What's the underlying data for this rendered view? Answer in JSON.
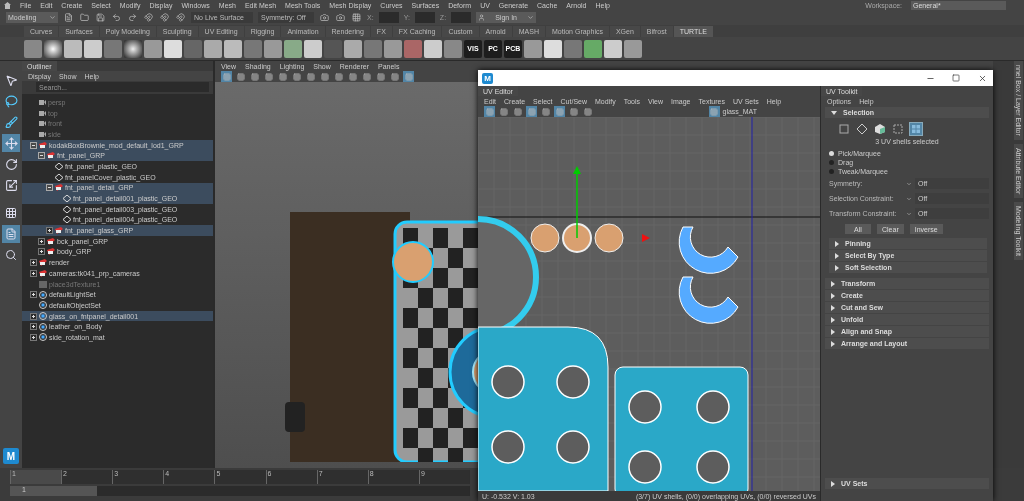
{
  "menu_bar": {
    "items": [
      "File",
      "Edit",
      "Create",
      "Select",
      "Modify",
      "Display",
      "Windows",
      "Mesh",
      "Edit Mesh",
      "Mesh Tools",
      "Mesh Display",
      "Curves",
      "Surfaces",
      "Deform",
      "UV",
      "Generate",
      "Cache",
      "Arnold",
      "Help"
    ],
    "workspace_label": "Workspace:",
    "workspace_value": "General*"
  },
  "status_line": {
    "mode": "Modeling",
    "live_surface": "No Live Surface",
    "symmetry": "Symmetry: Off",
    "coords": [
      "X:",
      "Y:",
      "Z:"
    ],
    "sign_in": "Sign In"
  },
  "shelf": {
    "tabs": [
      {
        "label": "Curves",
        "selected": false
      },
      {
        "label": "Surfaces",
        "selected": false
      },
      {
        "label": "Poly Modeling",
        "selected": false
      },
      {
        "label": "Sculpting",
        "selected": false
      },
      {
        "label": "UV Editing",
        "selected": false
      },
      {
        "label": "Rigging",
        "selected": false
      },
      {
        "label": "Animation",
        "selected": false
      },
      {
        "label": "Rendering",
        "selected": false
      },
      {
        "label": "FX",
        "selected": false
      },
      {
        "label": "FX Caching",
        "selected": false
      },
      {
        "label": "Custom",
        "selected": false
      },
      {
        "label": "Arnold",
        "selected": false
      },
      {
        "label": "MASH",
        "selected": false
      },
      {
        "label": "Motion Graphics",
        "selected": false
      },
      {
        "label": "XGen",
        "selected": false
      },
      {
        "label": "Bifrost",
        "selected": false
      },
      {
        "label": "TURTLE",
        "selected": true
      }
    ],
    "text_icons": [
      "VIS",
      "PC",
      "PCB"
    ]
  },
  "toolbox": {
    "tools": [
      {
        "kind": "select",
        "selected": false
      },
      {
        "kind": "lasso",
        "selected": false
      },
      {
        "kind": "paint",
        "selected": false
      },
      {
        "kind": "move",
        "selected": true
      },
      {
        "kind": "rotate",
        "selected": false
      },
      {
        "kind": "scale",
        "selected": false
      }
    ],
    "logo": "M"
  },
  "outliner": {
    "title": "Outliner",
    "menus": [
      "Display",
      "Show",
      "Help"
    ],
    "search_placeholder": "Search...",
    "items": [
      {
        "label": "persp",
        "kind": "camera",
        "dimmed": true,
        "selected": false
      },
      {
        "label": "top",
        "kind": "camera",
        "dimmed": true,
        "selected": false
      },
      {
        "label": "front",
        "kind": "camera",
        "dimmed": true,
        "selected": false
      },
      {
        "label": "side",
        "kind": "camera",
        "dimmed": true,
        "selected": false
      },
      {
        "label": "kodakBoxBrownie_mod_default_lod1_GRP",
        "kind": "group",
        "selected": true,
        "expanded": true,
        "children": [
          {
            "label": "fnt_panel_GRP",
            "kind": "group",
            "selected": true,
            "expanded": true,
            "children": [
              {
                "label": "fnt_panel_plastic_GEO",
                "kind": "mesh",
                "selected": false
              },
              {
                "label": "fnt_panelCover_plastic_GEO",
                "kind": "mesh",
                "selected": false
              },
              {
                "label": "fnt_panel_detail_GRP",
                "kind": "group",
                "selected": true,
                "expanded": true,
                "children": [
                  {
                    "label": "fnt_panel_detail001_plastic_GEO",
                    "kind": "mesh",
                    "selected": true
                  },
                  {
                    "label": "fnt_panel_detail003_plastic_GEO",
                    "kind": "mesh",
                    "selected": false
                  },
                  {
                    "label": "fnt_panel_detail004_plastic_GEO",
                    "kind": "mesh",
                    "selected": false
                  }
                ]
              },
              {
                "label": "fnt_panel_glass_GRP",
                "kind": "group",
                "selected": true,
                "expanded": false
              }
            ]
          },
          {
            "label": "bck_panel_GRP",
            "kind": "group",
            "selected": false,
            "expanded": false
          },
          {
            "label": "body_GRP",
            "kind": "group",
            "selected": false,
            "expanded": false
          }
        ]
      },
      {
        "label": "render",
        "kind": "group",
        "selected": false,
        "expanded": false
      },
      {
        "label": "cameras:tk041_prp_cameras",
        "kind": "group",
        "selected": false,
        "expanded": false
      },
      {
        "label": "place3dTexture1",
        "kind": "texture",
        "dimmed": true,
        "selected": false
      },
      {
        "label": "defaultLightSet",
        "kind": "set",
        "selected": false,
        "expanded": false
      },
      {
        "label": "defaultObjectSet",
        "kind": "set",
        "selected": false
      },
      {
        "label": "glass_on_fntpanel_detail001",
        "kind": "set",
        "selected": true,
        "expanded": false
      },
      {
        "label": "leather_on_Body",
        "kind": "set",
        "selected": false,
        "expanded": false
      },
      {
        "label": "side_rotation_mat",
        "kind": "set",
        "selected": false,
        "expanded": false
      }
    ]
  },
  "viewport": {
    "menus": [
      "View",
      "Shading",
      "Lighting",
      "Show",
      "Renderer",
      "Panels"
    ]
  },
  "uv_editor": {
    "logo": "M",
    "tab": "UV Editor",
    "menus": [
      "Edit",
      "Create",
      "Select",
      "Cut/Sew",
      "Modify",
      "Tools",
      "View",
      "Image",
      "Textures",
      "UV Sets",
      "Help"
    ],
    "texture": "glass_MAT",
    "coords": "U: -0.532 V: 1.03",
    "info": "(3/7) UV shells, (0/0) overlapping UVs, (0/0) reversed UVs"
  },
  "uv_toolkit": {
    "tab": "UV Toolkit",
    "menus": [
      "Options",
      "Help"
    ],
    "selection": {
      "title": "Selection",
      "expanded": true,
      "modes": [
        {
          "kind": "vertex",
          "selected": false
        },
        {
          "kind": "edge",
          "selected": false
        },
        {
          "kind": "face",
          "selected": false
        },
        {
          "kind": "uv",
          "selected": false
        },
        {
          "kind": "shell",
          "selected": true
        }
      ],
      "summary": "3 UV shells selected",
      "pick_modes": [
        {
          "label": "Pick/Marquee",
          "selected": true
        },
        {
          "label": "Drag",
          "selected": false
        },
        {
          "label": "Tweak/Marquee",
          "selected": false
        }
      ],
      "options": [
        {
          "label": "Symmetry:",
          "value": "Off"
        },
        {
          "label": "Selection Constraint:",
          "value": "Off"
        },
        {
          "label": "Transform Constraint:",
          "value": "Off"
        }
      ],
      "buttons": [
        "All",
        "Clear",
        "Inverse"
      ],
      "subsections": [
        {
          "title": "Pinning",
          "expanded": false
        },
        {
          "title": "Select By Type",
          "expanded": false
        },
        {
          "title": "Soft Selection",
          "expanded": false
        }
      ]
    },
    "sections": [
      {
        "title": "Transform",
        "expanded": false
      },
      {
        "title": "Create",
        "expanded": false
      },
      {
        "title": "Cut and Sew",
        "expanded": false
      },
      {
        "title": "Unfold",
        "expanded": false
      },
      {
        "title": "Align and Snap",
        "expanded": false
      },
      {
        "title": "Arrange and Layout",
        "expanded": false
      }
    ],
    "footer": {
      "title": "UV Sets",
      "expanded": false
    }
  },
  "side_tabs": [
    "nnel Box / Layer Editor",
    "Attribute Editor",
    "Modeling Toolkit"
  ],
  "timeline": {
    "frames": [
      {
        "label": "1",
        "selected": true
      },
      {
        "label": "2",
        "selected": false
      },
      {
        "label": "3",
        "selected": false
      },
      {
        "label": "4",
        "selected": false
      },
      {
        "label": "5",
        "selected": false
      },
      {
        "label": "6",
        "selected": false
      },
      {
        "label": "7",
        "selected": false
      },
      {
        "label": "8",
        "selected": false
      },
      {
        "label": "9",
        "selected": false
      }
    ],
    "range": {
      "label": "1",
      "level": 0.19
    }
  }
}
